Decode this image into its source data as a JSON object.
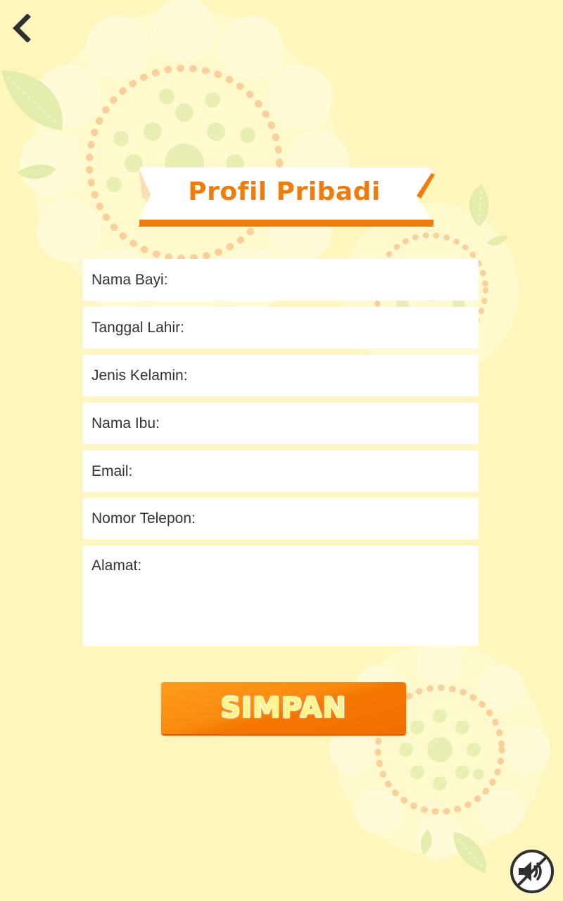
{
  "header": {
    "back_icon": "chevron-left-icon",
    "title": "Profil Pribadi"
  },
  "form": {
    "fields": [
      {
        "label": "Nama Bayi:"
      },
      {
        "label": "Tanggal Lahir:"
      },
      {
        "label": "Jenis Kelamin:"
      },
      {
        "label": "Nama Ibu:"
      },
      {
        "label": "Email:"
      },
      {
        "label": "Nomor Telepon:"
      },
      {
        "label": "Alamat:"
      }
    ],
    "save_label": "SIMPAN"
  },
  "footer": {
    "sound_icon": "sound-muted-icon"
  },
  "colors": {
    "background": "#fff6bd",
    "accent_orange": "#f07c0b",
    "button_text": "#fff48a"
  }
}
